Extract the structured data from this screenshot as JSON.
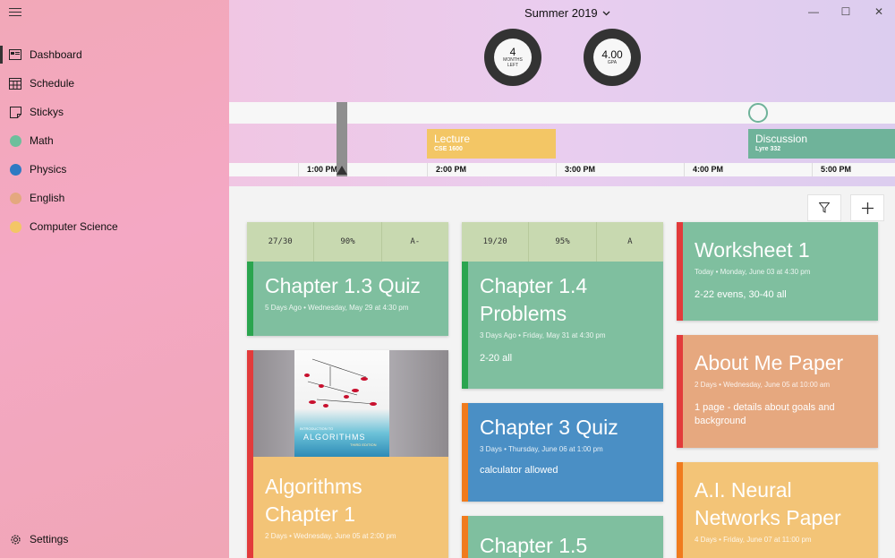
{
  "colors": {
    "math": "#6dbf9c",
    "physics": "#2e7ac3",
    "english": "#e4a87f",
    "cs": "#f3c665",
    "red_accent": "#e23b3b",
    "green_accent": "#2aa54f",
    "orange_accent": "#f07b1d"
  },
  "sidebar": {
    "menu_icon": "hamburger-icon",
    "items": [
      {
        "label": "Dashboard",
        "icon": "dashboard-icon"
      },
      {
        "label": "Schedule",
        "icon": "calendar-icon"
      },
      {
        "label": "Stickys",
        "icon": "sticky-note-icon"
      },
      {
        "label": "Math",
        "icon": "dot"
      },
      {
        "label": "Physics",
        "icon": "dot"
      },
      {
        "label": "English",
        "icon": "dot"
      },
      {
        "label": "Computer Science",
        "icon": "dot"
      }
    ],
    "settings_label": "Settings"
  },
  "header": {
    "term": "Summer 2019",
    "months_left": {
      "value": "4",
      "label1": "Months",
      "label2": "Left"
    },
    "gpa": {
      "value": "4.00",
      "label": "GPA"
    }
  },
  "timeline": {
    "events": [
      {
        "title": "Lecture",
        "subtitle": "CSE 1600"
      },
      {
        "title": "Discussion",
        "subtitle": "Lyre 332"
      }
    ],
    "ticks": [
      "1:00 PM",
      "2:00 PM",
      "3:00 PM",
      "4:00 PM",
      "5:00 PM"
    ]
  },
  "cards": {
    "ch13": {
      "grades": [
        "27/30",
        "90%",
        "A-"
      ],
      "title": "Chapter 1.3 Quiz",
      "meta": "5 Days Ago • Wednesday, May 29 at 4:30 pm"
    },
    "algorithms": {
      "book_title": "ALGORITHMS",
      "book_pre": "INTRODUCTION TO",
      "book_edition": "THIRD EDITION",
      "title": "Algorithms Chapter 1",
      "meta": "2 Days • Wednesday, June 05 at 2:00 pm"
    },
    "ch14": {
      "grades": [
        "19/20",
        "95%",
        "A"
      ],
      "title": "Chapter 1.4 Problems",
      "meta": "3 Days Ago • Friday, May 31 at 4:30 pm",
      "desc": "2-20 all"
    },
    "ch3": {
      "title": "Chapter 3 Quiz",
      "meta": "3 Days • Thursday, June 06 at 1:00 pm",
      "desc": "calculator allowed"
    },
    "ch15": {
      "title": "Chapter 1.5"
    },
    "worksheet": {
      "title": "Worksheet 1",
      "meta": "Today • Monday, June 03 at 4:30 pm",
      "desc": "2-22 evens, 30-40 all"
    },
    "aboutme": {
      "title": "About Me Paper",
      "meta": "2 Days • Wednesday, June 05 at 10:00 am",
      "desc": "1 page - details about goals and background"
    },
    "ai": {
      "title": "A.I. Neural Networks Paper",
      "meta": "4 Days • Friday, June 07 at 11:00 pm"
    }
  }
}
